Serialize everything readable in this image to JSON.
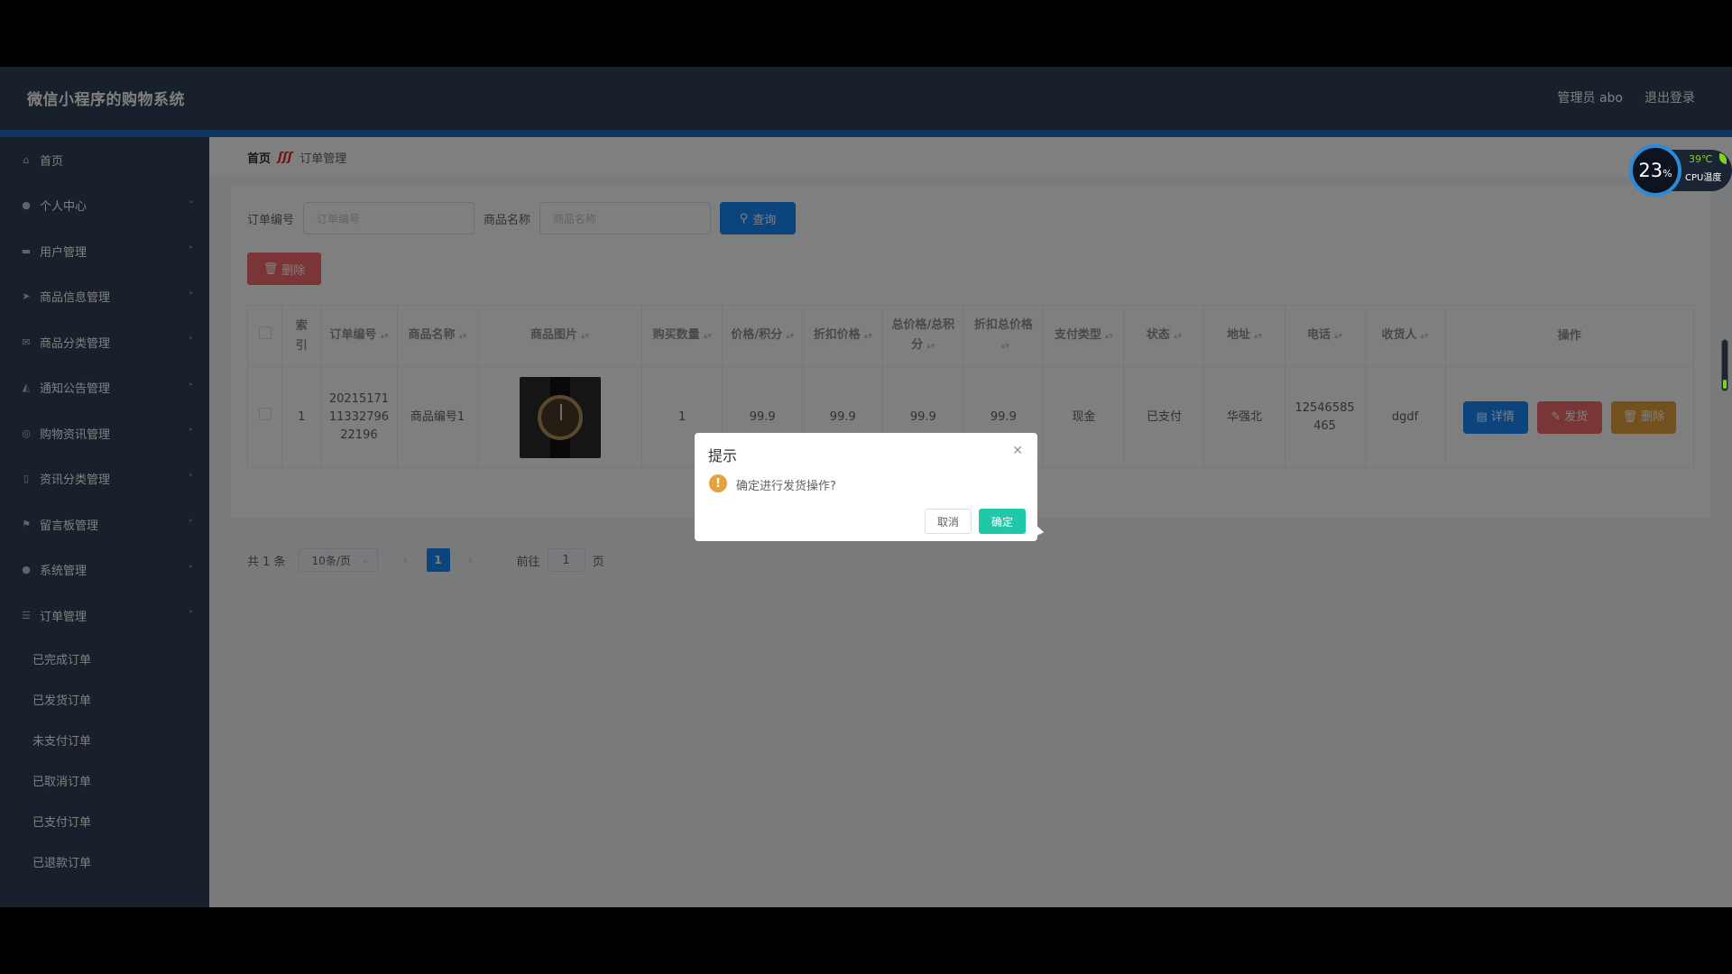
{
  "header": {
    "title": "微信小程序的购物系统",
    "user": "管理员 abo",
    "logout": "退出登录"
  },
  "sidebar": {
    "items": [
      {
        "label": "首页",
        "icon": "home-icon",
        "glyph": "⌂",
        "has_chevron": false
      },
      {
        "label": "个人中心",
        "icon": "user-icon",
        "glyph": "●",
        "has_chevron": true
      },
      {
        "label": "用户管理",
        "icon": "monitor-icon",
        "glyph": "▬",
        "has_chevron": true
      },
      {
        "label": "商品信息管理",
        "icon": "send-icon",
        "glyph": "➤",
        "has_chevron": true
      },
      {
        "label": "商品分类管理",
        "icon": "mail-icon",
        "glyph": "✉",
        "has_chevron": true
      },
      {
        "label": "通知公告管理",
        "icon": "megaphone-icon",
        "glyph": "◭",
        "has_chevron": true
      },
      {
        "label": "购物资讯管理",
        "icon": "compass-icon",
        "glyph": "◎",
        "has_chevron": true
      },
      {
        "label": "资讯分类管理",
        "icon": "mic-icon",
        "glyph": "▯",
        "has_chevron": true
      },
      {
        "label": "留言板管理",
        "icon": "flag-icon",
        "glyph": "⚑",
        "has_chevron": true
      },
      {
        "label": "系统管理",
        "icon": "user-icon",
        "glyph": "●",
        "has_chevron": true
      },
      {
        "label": "订单管理",
        "icon": "menu-icon",
        "glyph": "☰",
        "has_chevron": true
      }
    ],
    "sub_items": [
      "已完成订单",
      "已发货订单",
      "未支付订单",
      "已取消订单",
      "已支付订单",
      "已退款订单"
    ]
  },
  "breadcrumb": {
    "home": "首页",
    "separator": "ʃʃʃ",
    "current": "订单管理"
  },
  "search": {
    "order_label": "订单编号",
    "order_placeholder": "订单编号",
    "name_label": "商品名称",
    "name_placeholder": "商品名称",
    "query_button": "查询"
  },
  "toolbar": {
    "delete_button": "删除"
  },
  "table": {
    "headers": [
      "索引",
      "订单编号",
      "商品名称",
      "商品图片",
      "购买数量",
      "价格/积分",
      "折扣价格",
      "总价格/总积分",
      "折扣总价格",
      "支付类型",
      "状态",
      "地址",
      "电话",
      "收货人",
      "操作"
    ],
    "rows": [
      {
        "index": "1",
        "order_no": "202151711133279622196",
        "product_name": "商品编号1",
        "quantity": "1",
        "price": "99.9",
        "discount_price": "99.9",
        "total_price": "99.9",
        "discount_total": "99.9",
        "pay_type": "现金",
        "status": "已支付",
        "address": "华强北",
        "phone": "12546585465",
        "receiver": "dgdf",
        "actions": {
          "detail": "详情",
          "ship": "发货",
          "delete": "删除"
        }
      }
    ]
  },
  "pagination": {
    "total": "共 1 条",
    "page_size": "10条/页",
    "current_page": "1",
    "goto_label": "前往",
    "goto_value": "1",
    "page_suffix": "页"
  },
  "cpu_widget": {
    "usage": "23",
    "usage_unit": "%",
    "temp": "39℃",
    "label": "CPU温度"
  },
  "dialog": {
    "title": "提示",
    "message": "确定进行发货操作?",
    "cancel": "取消",
    "confirm": "确定"
  },
  "colors": {
    "header_bg": "#304156",
    "primary": "#1989fa",
    "danger": "#f56c6c",
    "warning": "#e6a23c",
    "confirm": "#1fc8a8"
  }
}
